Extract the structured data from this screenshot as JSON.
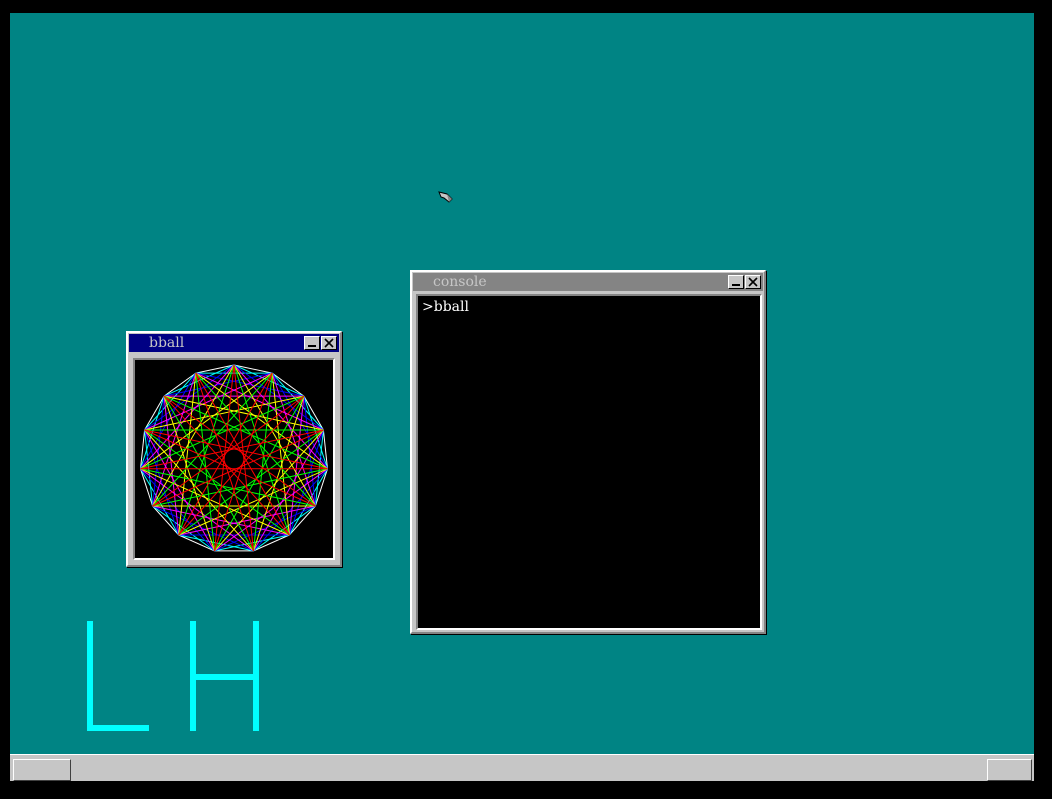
{
  "desktop": {
    "background_color": "#008484",
    "logo_text": "LH",
    "logo_color": "#00ffff"
  },
  "windows": {
    "bball": {
      "title": "bball",
      "active": true,
      "buttons": [
        "minimize-icon",
        "close-icon"
      ],
      "content": "string-art-polygon",
      "colors": [
        "#ff0000",
        "#00ff00",
        "#ffff00",
        "#0000ff",
        "#ff00ff",
        "#00ffff",
        "#ffffff"
      ]
    },
    "console": {
      "title": "console",
      "active": false,
      "buttons": [
        "minimize-icon",
        "close-icon"
      ],
      "prompt_line": ">bball"
    }
  },
  "taskbar": {
    "start_button": "",
    "tray_button": ""
  },
  "cursor": "mouse-pointer-icon"
}
